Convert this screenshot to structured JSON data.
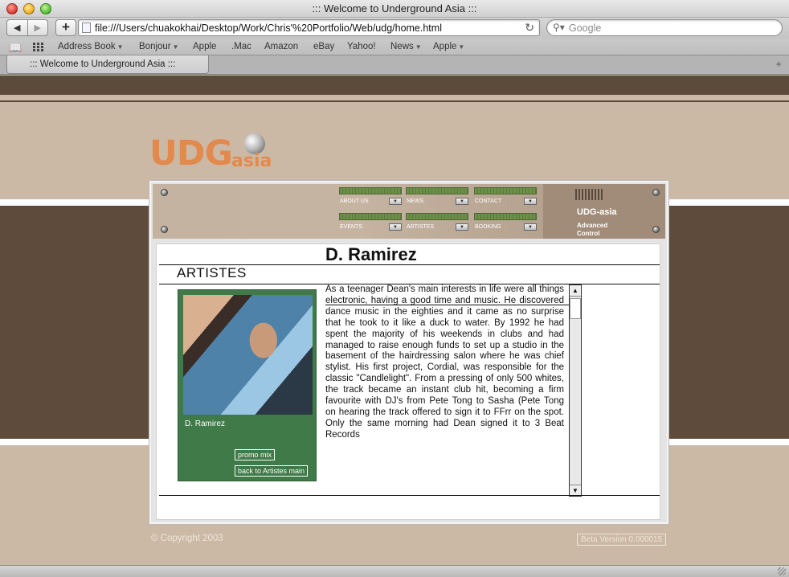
{
  "browser": {
    "window_title": "::: Welcome to Underground Asia :::",
    "url": "file:///Users/chuakokhai/Desktop/Work/Chris'%20Portfolio/Web/udg/home.html",
    "search_placeholder": "Google",
    "bookmarks": [
      {
        "label": "Address Book",
        "menu": true
      },
      {
        "label": "Bonjour",
        "menu": true
      },
      {
        "label": "Apple",
        "menu": false
      },
      {
        "label": ".Mac",
        "menu": false
      },
      {
        "label": "Amazon",
        "menu": false
      },
      {
        "label": "eBay",
        "menu": false
      },
      {
        "label": "Yahoo!",
        "menu": false
      },
      {
        "label": "News",
        "menu": true
      },
      {
        "label": "Apple",
        "menu": true
      }
    ],
    "tab_label": "::: Welcome to Underground Asia :::"
  },
  "site": {
    "logo_main": "UDG",
    "logo_sub": "asia",
    "brand_color": "#e28a4e",
    "control": {
      "brand": "UDG-asia",
      "sub_line1": "Advanced",
      "sub_line2": "Control"
    },
    "nav": [
      {
        "label": "ABOUT US"
      },
      {
        "label": "NEWS"
      },
      {
        "label": "CONTACT"
      },
      {
        "label": "EVENTS"
      },
      {
        "label": "ARTISTES"
      },
      {
        "label": "BOOKING"
      }
    ],
    "section_title": "ARTISTES",
    "artist": {
      "name": "D. Ramirez",
      "caption": "D. Ramirez",
      "promo_link": "promo mix",
      "back_link": "back to Artistes main",
      "bio": "As a teenager Dean's main interests in life were all things electronic, having a good time and music. He discovered dance music in the eighties and it came as no surprise that he took to it like a duck to water.  By 1992 he had spent the majority of his weekends in clubs and had managed to raise enough funds to set up a studio in the basement of the hairdressing salon where he was chief stylist. His first project, Cordial, was responsible for the classic \"Candlelight\".  From a pressing of only 500 whites, the track became an instant club hit, becoming a firm favourite with DJ's from Pete Tong to Sasha (Pete Tong on hearing the track offered to sign it to FFrr on the spot.  Only the same morning had Dean signed it to 3 Beat Records"
    },
    "copyright": "© Copyright 2003",
    "beta": "Beta Version 0.000015"
  }
}
